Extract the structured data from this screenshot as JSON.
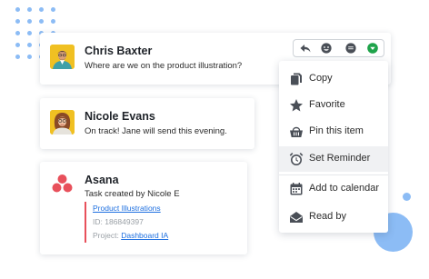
{
  "messages": [
    {
      "name": "Chris Baxter",
      "text": "Where are we on the product illustration?"
    },
    {
      "name": "Nicole Evans",
      "text": "On track! Jane will send this evening."
    },
    {
      "name": "Asana",
      "text": "Task created by Nicole E"
    }
  ],
  "attachment": {
    "title": "Product Illustrations",
    "id_label": "ID:",
    "id_value": "186849397",
    "project_label": "Project:",
    "project_value": "Dashboard IA"
  },
  "message_actions": [
    "reply-icon",
    "emoji-icon",
    "comment-icon",
    "more-dropdown-icon"
  ],
  "context_menu": {
    "items": [
      {
        "label": "Copy",
        "icon": "copy-icon"
      },
      {
        "label": "Favorite",
        "icon": "star-icon"
      },
      {
        "label": "Pin this item",
        "icon": "pin-basket-icon"
      },
      {
        "label": "Set Reminder",
        "icon": "alarm-clock-icon",
        "active": true
      },
      {
        "label": "Add to calendar",
        "icon": "calendar-icon"
      },
      {
        "label": "Read by",
        "icon": "envelope-open-icon"
      }
    ]
  },
  "colors": {
    "accent_blue": "#8cbcf5",
    "link_blue": "#1d6fe0",
    "asana_red": "#e8505b",
    "dropdown_green": "#1fa34a",
    "avatar_yellow": "#f0c022"
  }
}
